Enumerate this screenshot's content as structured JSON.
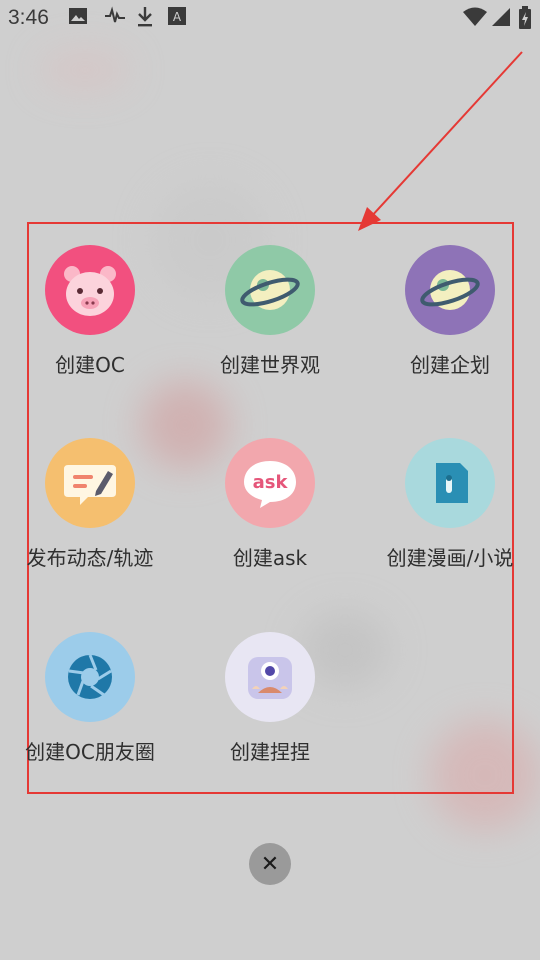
{
  "status_bar": {
    "time": "3:46",
    "icons": [
      "image-icon",
      "activity-icon",
      "download-icon",
      "translate-icon",
      "wifi-icon",
      "signal-icon",
      "battery-icon"
    ],
    "translate_glyph": "A"
  },
  "menu": {
    "items": [
      {
        "label": "创建OC",
        "icon": "pig-face-icon",
        "color": "#f2507f"
      },
      {
        "label": "创建世界观",
        "icon": "planet-icon",
        "color": "#8fc9a7"
      },
      {
        "label": "创建企划",
        "icon": "planet-icon",
        "color": "#8e73b7"
      },
      {
        "label": "发布动态/轨迹",
        "icon": "edit-note-icon",
        "color": "#f5bf6f"
      },
      {
        "label": "创建ask",
        "icon": "ask-bubble-icon",
        "color": "#f2a7ad",
        "icon_text": "ask"
      },
      {
        "label": "创建漫画/小说",
        "icon": "book-icon",
        "color": "#a9d9dd"
      },
      {
        "label": "创建OC朋友圈",
        "icon": "aperture-icon",
        "color": "#9cccea"
      },
      {
        "label": "创建捏捏",
        "icon": "one-eye-monster-icon",
        "color": "#e8e6f3"
      }
    ]
  },
  "close": {
    "icon": "close-icon",
    "glyph": "✕"
  },
  "colors": {
    "highlight": "#e53935",
    "label_text": "#2f2f2f"
  }
}
